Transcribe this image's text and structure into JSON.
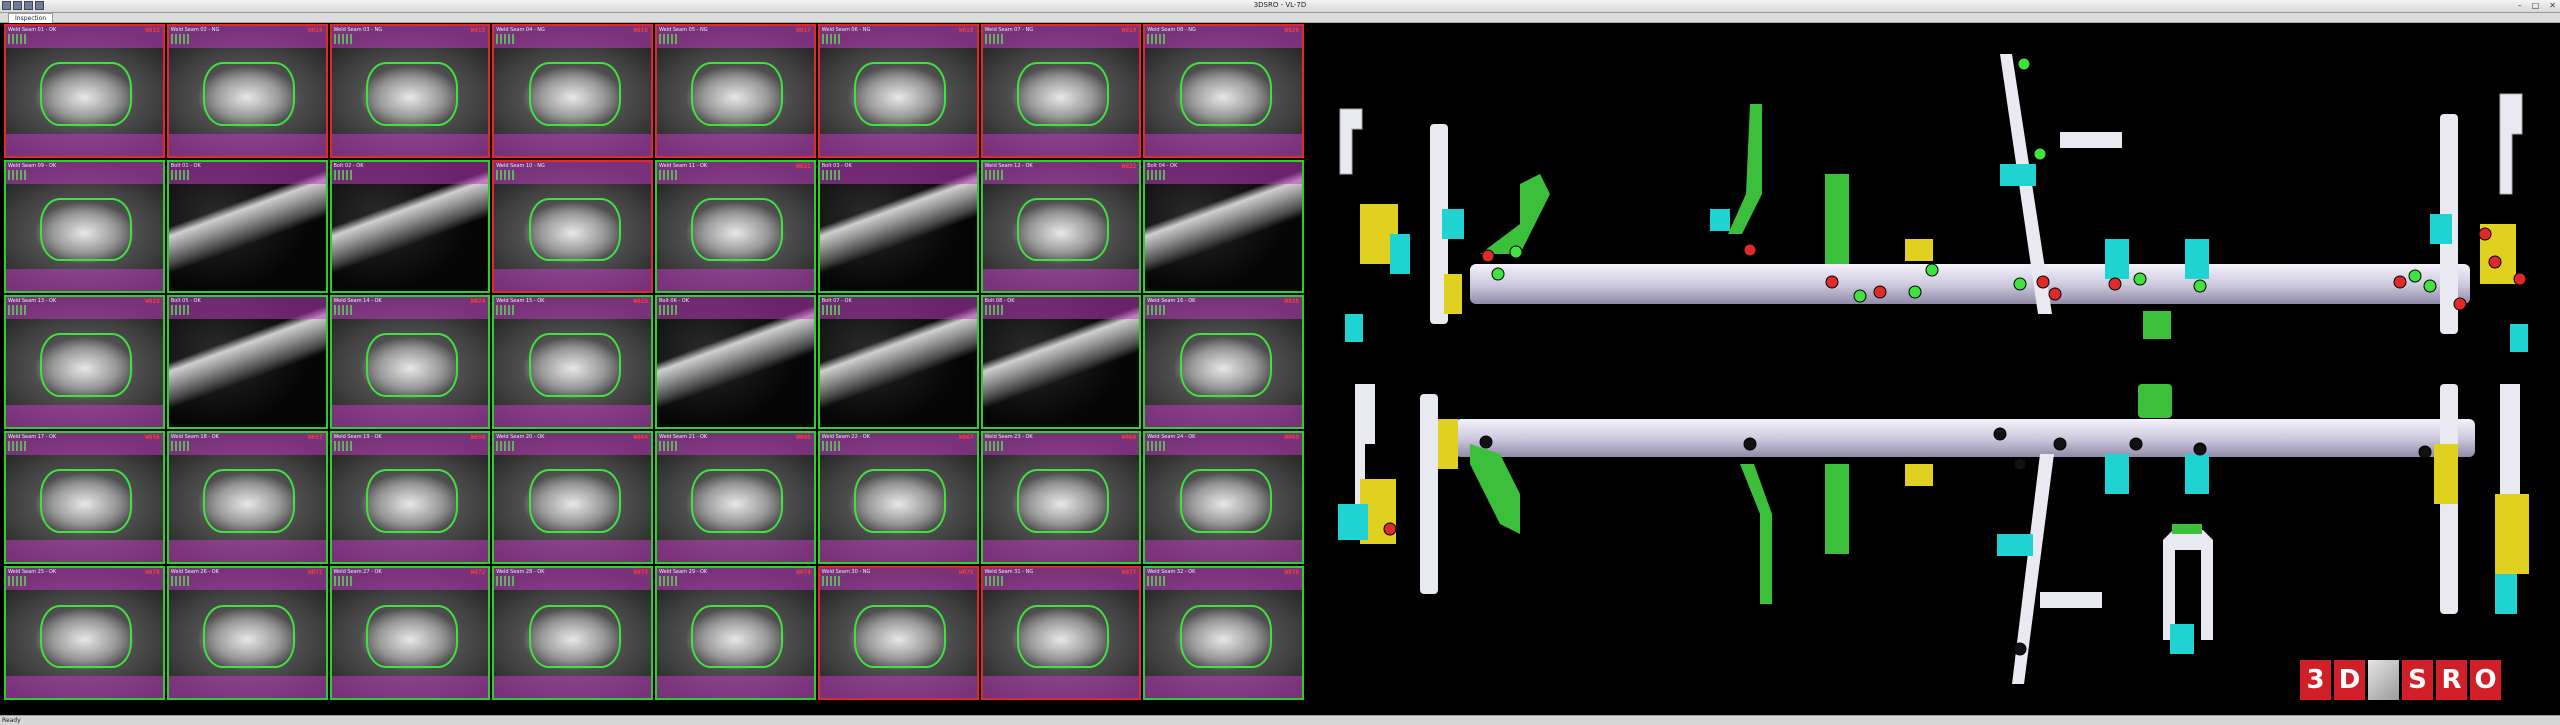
{
  "window": {
    "title": "3DSRO - VL-7D",
    "controls": [
      "–",
      "□",
      "✕"
    ]
  },
  "tabs": [
    {
      "label": "Inspection"
    }
  ],
  "status": {
    "text": "Ready"
  },
  "logo": {
    "letters": [
      "3",
      "D",
      "",
      "S",
      "R",
      "O"
    ]
  },
  "cells": [
    {
      "kind": "weld",
      "status": "fail",
      "idx": "W013",
      "label": "Weld Seam 01 - OK"
    },
    {
      "kind": "weld",
      "status": "fail",
      "idx": "W014",
      "label": "Weld Seam 02 - NG"
    },
    {
      "kind": "weld",
      "status": "fail",
      "idx": "W015",
      "label": "Weld Seam 03 - NG"
    },
    {
      "kind": "weld",
      "status": "fail",
      "idx": "W016",
      "label": "Weld Seam 04 - NG"
    },
    {
      "kind": "weld",
      "status": "fail",
      "idx": "W017",
      "label": "Weld Seam 05 - NG"
    },
    {
      "kind": "weld",
      "status": "fail",
      "idx": "W018",
      "label": "Weld Seam 06 - NG"
    },
    {
      "kind": "weld",
      "status": "fail",
      "idx": "W019",
      "label": "Weld Seam 07 - NG"
    },
    {
      "kind": "weld",
      "status": "fail",
      "idx": "W020",
      "label": "Weld Seam 08 - NG"
    },
    {
      "kind": "weld",
      "status": "pass",
      "idx": "",
      "label": "Weld Seam 09 - OK"
    },
    {
      "kind": "bolt",
      "status": "pass",
      "idx": "",
      "label": "Bolt 01 - OK"
    },
    {
      "kind": "bolt",
      "status": "pass",
      "idx": "",
      "label": "Bolt 02 - OK"
    },
    {
      "kind": "weld",
      "status": "fail",
      "idx": "",
      "label": "Weld Seam 10 - NG"
    },
    {
      "kind": "weld",
      "status": "pass",
      "idx": "W021",
      "label": "Weld Seam 11 - OK"
    },
    {
      "kind": "bolt",
      "status": "pass",
      "idx": "",
      "label": "Bolt 03 - OK"
    },
    {
      "kind": "weld",
      "status": "pass",
      "idx": "W022",
      "label": "Weld Seam 12 - OK"
    },
    {
      "kind": "bolt",
      "status": "pass",
      "idx": "",
      "label": "Bolt 04 - OK"
    },
    {
      "kind": "weld",
      "status": "pass",
      "idx": "W023",
      "label": "Weld Seam 13 - OK"
    },
    {
      "kind": "bolt",
      "status": "pass",
      "idx": "",
      "label": "Bolt 05 - OK"
    },
    {
      "kind": "weld",
      "status": "pass",
      "idx": "W024",
      "label": "Weld Seam 14 - OK"
    },
    {
      "kind": "weld",
      "status": "pass",
      "idx": "W025",
      "label": "Weld Seam 15 - OK"
    },
    {
      "kind": "bolt",
      "status": "pass",
      "idx": "",
      "label": "Bolt 06 - OK"
    },
    {
      "kind": "bolt",
      "status": "pass",
      "idx": "",
      "label": "Bolt 07 - OK"
    },
    {
      "kind": "bolt",
      "status": "pass",
      "idx": "",
      "label": "Bolt 08 - OK"
    },
    {
      "kind": "weld",
      "status": "pass",
      "idx": "W026",
      "label": "Weld Seam 16 - OK"
    },
    {
      "kind": "weld",
      "status": "pass",
      "idx": "W056",
      "label": "Weld Seam 17 - OK"
    },
    {
      "kind": "weld",
      "status": "pass",
      "idx": "W057",
      "label": "Weld Seam 18 - OK"
    },
    {
      "kind": "weld",
      "status": "pass",
      "idx": "W058",
      "label": "Weld Seam 19 - OK"
    },
    {
      "kind": "weld",
      "status": "pass",
      "idx": "W064",
      "label": "Weld Seam 20 - OK"
    },
    {
      "kind": "weld",
      "status": "pass",
      "idx": "W065",
      "label": "Weld Seam 21 - OK"
    },
    {
      "kind": "weld",
      "status": "pass",
      "idx": "W067",
      "label": "Weld Seam 22 - OK"
    },
    {
      "kind": "weld",
      "status": "pass",
      "idx": "W068",
      "label": "Weld Seam 23 - OK"
    },
    {
      "kind": "weld",
      "status": "pass",
      "idx": "W069",
      "label": "Weld Seam 24 - OK"
    },
    {
      "kind": "weld",
      "status": "pass",
      "idx": "W070",
      "label": "Weld Seam 25 - OK"
    },
    {
      "kind": "weld",
      "status": "pass",
      "idx": "W071",
      "label": "Weld Seam 26 - OK"
    },
    {
      "kind": "weld",
      "status": "pass",
      "idx": "W072",
      "label": "Weld Seam 27 - OK"
    },
    {
      "kind": "weld",
      "status": "pass",
      "idx": "W073",
      "label": "Weld Seam 28 - OK"
    },
    {
      "kind": "weld",
      "status": "pass",
      "idx": "W074",
      "label": "Weld Seam 29 - OK"
    },
    {
      "kind": "weld",
      "status": "fail",
      "idx": "W075",
      "label": "Weld Seam 30 - NG"
    },
    {
      "kind": "weld",
      "status": "fail",
      "idx": "W077",
      "label": "Weld Seam 31 - NG"
    },
    {
      "kind": "weld",
      "status": "pass",
      "idx": "W078",
      "label": "Weld Seam 32 - OK"
    }
  ],
  "colors": {
    "pass": "#2bd12b",
    "fail": "#e02a2a",
    "overlay": "#be3cbe",
    "tube": "#d8d4e8",
    "cyan": "#1fd3d3",
    "yellow": "#e0d020",
    "green": "#3cc03c",
    "logo_red": "#d11f2a"
  }
}
